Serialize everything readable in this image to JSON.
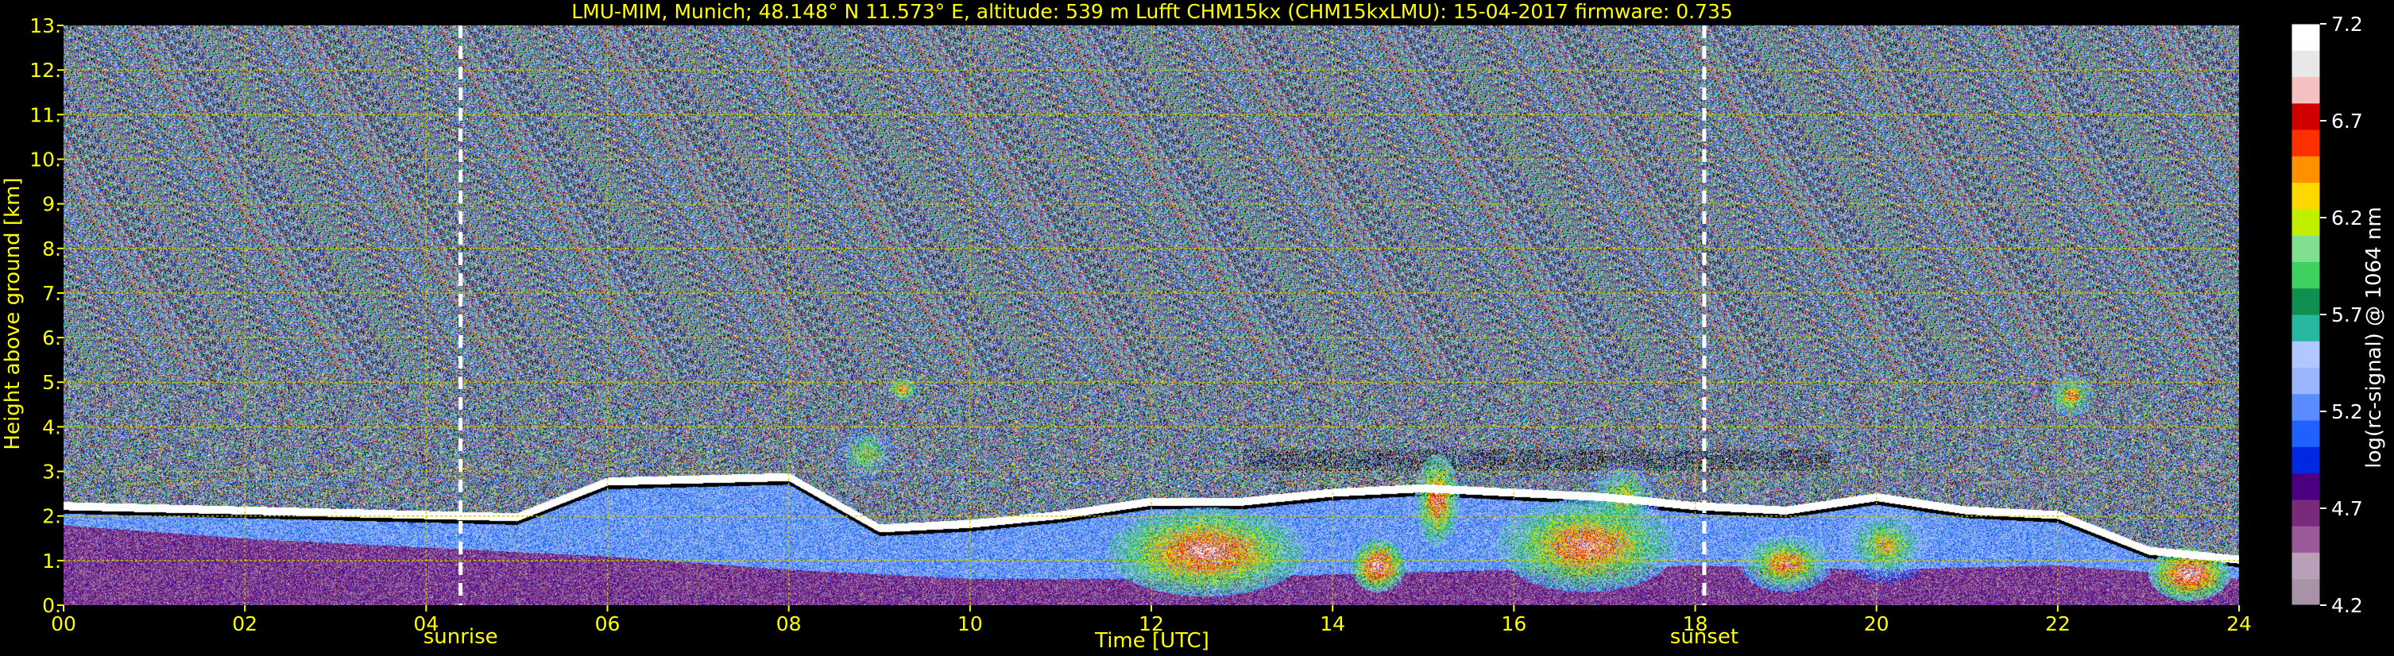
{
  "chart_data": {
    "type": "heatmap",
    "title": "LMU-MIM, Munich; 48.148° N 11.573° E, altitude: 539 m     Lufft CHM15kx (CHM15kxLMU): 15-04-2017     firmware: 0.735",
    "xlabel": "Time [UTC]",
    "ylabel": "Height above ground [km]",
    "xlim": [
      0,
      24
    ],
    "ylim": [
      0,
      13
    ],
    "x_ticks": [
      "00",
      "02",
      "04",
      "06",
      "08",
      "10",
      "12",
      "14",
      "16",
      "18",
      "20",
      "22",
      "24"
    ],
    "x_tick_values": [
      0,
      2,
      4,
      6,
      8,
      10,
      12,
      14,
      16,
      18,
      20,
      22,
      24
    ],
    "y_ticks": [
      "0.",
      "1.",
      "2.",
      "3.",
      "4.",
      "5.",
      "6.",
      "7.",
      "8.",
      "9.",
      "10.",
      "11.",
      "12.",
      "13."
    ],
    "y_tick_values": [
      0,
      1,
      2,
      3,
      4,
      5,
      6,
      7,
      8,
      9,
      10,
      11,
      12,
      13
    ],
    "grid": true,
    "grid_color": "#c8c800",
    "annotations": [
      {
        "label": "sunrise",
        "x": 4.38
      },
      {
        "label": "sunset",
        "x": 18.1
      }
    ],
    "colorbar": {
      "label": "log(rc-signal) @ 1064 nm",
      "range": [
        4.2,
        7.2
      ],
      "ticks": [
        "7.2",
        "6.7",
        "6.2",
        "5.7",
        "5.2",
        "4.7",
        "4.2"
      ],
      "tick_values": [
        7.2,
        6.7,
        6.2,
        5.7,
        5.2,
        4.7,
        4.2
      ],
      "colors": [
        "#a892a8",
        "#b8a0b8",
        "#9a5a9a",
        "#7a2a7a",
        "#4a0080",
        "#0028e0",
        "#2060ff",
        "#5a8cff",
        "#9ab6ff",
        "#b0c8ff",
        "#28b8a0",
        "#109050",
        "#40d060",
        "#80e090",
        "#c0f000",
        "#ffd800",
        "#ff9000",
        "#ff3000",
        "#d00000",
        "#f4c0c0",
        "#e8e8e8",
        "#ffffff"
      ]
    },
    "boundary_layer_height_km": [
      {
        "x": 0,
        "y": 2.2
      },
      {
        "x": 1,
        "y": 2.15
      },
      {
        "x": 2,
        "y": 2.1
      },
      {
        "x": 3,
        "y": 2.05
      },
      {
        "x": 4,
        "y": 2.0
      },
      {
        "x": 5,
        "y": 1.95
      },
      {
        "x": 6,
        "y": 2.75
      },
      {
        "x": 7,
        "y": 2.8
      },
      {
        "x": 8,
        "y": 2.85
      },
      {
        "x": 9,
        "y": 1.7
      },
      {
        "x": 10,
        "y": 1.8
      },
      {
        "x": 11,
        "y": 2.0
      },
      {
        "x": 12,
        "y": 2.3
      },
      {
        "x": 13,
        "y": 2.3
      },
      {
        "x": 14,
        "y": 2.5
      },
      {
        "x": 15,
        "y": 2.6
      },
      {
        "x": 16,
        "y": 2.5
      },
      {
        "x": 17,
        "y": 2.4
      },
      {
        "x": 18,
        "y": 2.2
      },
      {
        "x": 19,
        "y": 2.1
      },
      {
        "x": 20,
        "y": 2.4
      },
      {
        "x": 21,
        "y": 2.1
      },
      {
        "x": 22,
        "y": 2.0
      },
      {
        "x": 23,
        "y": 1.2
      },
      {
        "x": 24,
        "y": 1.0
      }
    ],
    "aerosol_layer_top_km": [
      {
        "x": 0,
        "y": 1.8
      },
      {
        "x": 2,
        "y": 1.5
      },
      {
        "x": 4,
        "y": 1.3
      },
      {
        "x": 6,
        "y": 1.1
      },
      {
        "x": 8,
        "y": 0.8
      },
      {
        "x": 10,
        "y": 0.6
      },
      {
        "x": 12,
        "y": 0.6
      },
      {
        "x": 14,
        "y": 0.7
      },
      {
        "x": 16,
        "y": 0.8
      },
      {
        "x": 18,
        "y": 0.9
      },
      {
        "x": 20,
        "y": 0.8
      },
      {
        "x": 22,
        "y": 0.9
      },
      {
        "x": 24,
        "y": 0.6
      }
    ],
    "features": [
      {
        "x0": 11.5,
        "x1": 13.7,
        "y0": 0.2,
        "y1": 2.2,
        "max_value": 7.0
      },
      {
        "x0": 14.2,
        "x1": 14.8,
        "y0": 0.3,
        "y1": 1.5,
        "max_value": 7.1
      },
      {
        "x0": 14.9,
        "x1": 15.4,
        "y0": 1.3,
        "y1": 3.4,
        "max_value": 6.9
      },
      {
        "x0": 15.8,
        "x1": 17.8,
        "y0": 0.3,
        "y1": 2.4,
        "max_value": 6.9
      },
      {
        "x0": 16.8,
        "x1": 17.6,
        "y0": 1.6,
        "y1": 3.2,
        "max_value": 6.4
      },
      {
        "x0": 18.5,
        "x1": 19.5,
        "y0": 0.3,
        "y1": 1.6,
        "max_value": 6.8
      },
      {
        "x0": 19.6,
        "x1": 20.6,
        "y0": 0.5,
        "y1": 2.2,
        "max_value": 6.5
      },
      {
        "x0": 23.0,
        "x1": 23.9,
        "y0": 0.1,
        "y1": 1.3,
        "max_value": 7.1
      },
      {
        "x0": 21.9,
        "x1": 22.4,
        "y0": 4.2,
        "y1": 5.2,
        "max_value": 6.6
      },
      {
        "x0": 9.1,
        "x1": 9.4,
        "y0": 4.6,
        "y1": 5.1,
        "max_value": 6.8
      },
      {
        "x0": 8.5,
        "x1": 9.2,
        "y0": 2.7,
        "y1": 4.1,
        "max_value": 6.2
      }
    ]
  }
}
